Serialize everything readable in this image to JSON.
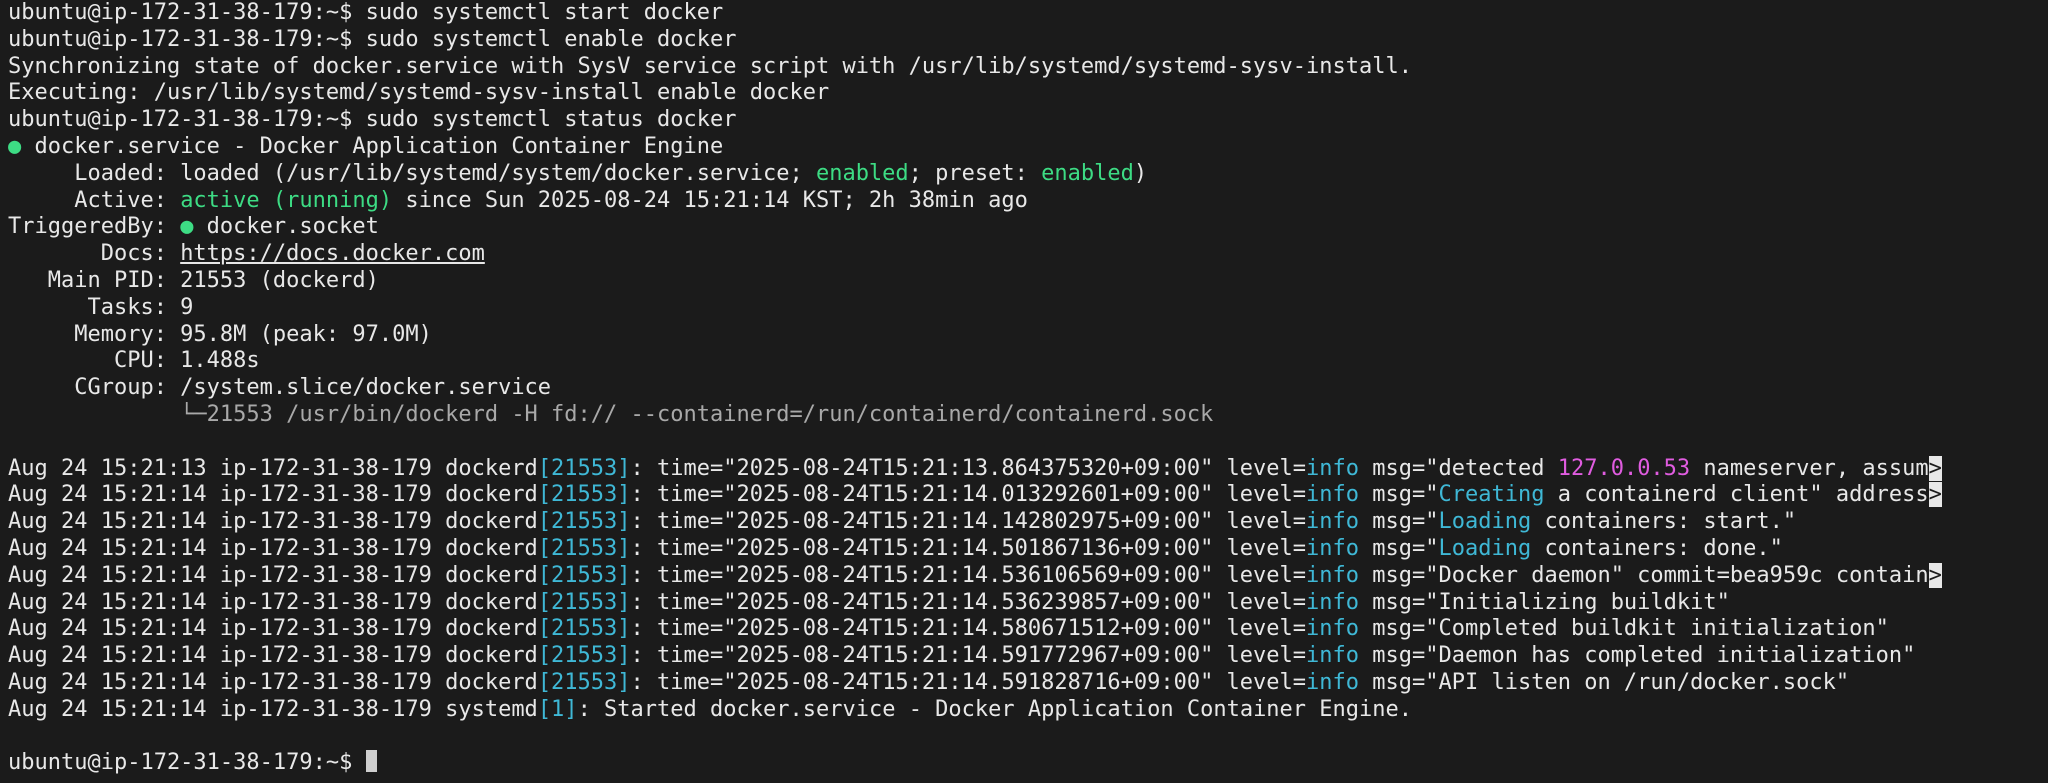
{
  "terminal": {
    "lines": [
      [
        {
          "t": "ubuntu@ip-172-31-38-179:~$ sudo systemctl start docker"
        }
      ],
      [
        {
          "t": "ubuntu@ip-172-31-38-179:~$ sudo systemctl enable docker"
        }
      ],
      [
        {
          "t": "Synchronizing state of docker.service with SysV service script with /usr/lib/systemd/systemd-sysv-install."
        }
      ],
      [
        {
          "t": "Executing: /usr/lib/systemd/systemd-sysv-install enable docker"
        }
      ],
      [
        {
          "t": "ubuntu@ip-172-31-38-179:~$ sudo systemctl status docker"
        }
      ],
      [
        {
          "t": "●",
          "c": "green"
        },
        {
          "t": " docker.service - Docker Application Container Engine"
        }
      ],
      [
        {
          "t": "     Loaded: loaded (/usr/lib/systemd/system/docker.service; "
        },
        {
          "t": "enabled",
          "c": "green"
        },
        {
          "t": "; preset: "
        },
        {
          "t": "enabled",
          "c": "green"
        },
        {
          "t": ")"
        }
      ],
      [
        {
          "t": "     Active: "
        },
        {
          "t": "active (running)",
          "c": "green"
        },
        {
          "t": " since Sun 2025-08-24 15:21:14 KST; 2h 38min ago"
        }
      ],
      [
        {
          "t": "TriggeredBy: "
        },
        {
          "t": "●",
          "c": "green"
        },
        {
          "t": " docker.socket"
        }
      ],
      [
        {
          "t": "       Docs: "
        },
        {
          "t": "https://docs.docker.com",
          "c": "link"
        }
      ],
      [
        {
          "t": "   Main PID: 21553 (dockerd)"
        }
      ],
      [
        {
          "t": "      Tasks: 9"
        }
      ],
      [
        {
          "t": "     Memory: 95.8M (peak: 97.0M)"
        }
      ],
      [
        {
          "t": "        CPU: 1.488s"
        }
      ],
      [
        {
          "t": "     CGroup: /system.slice/docker.service"
        }
      ],
      [
        {
          "t": "             └─21553 /usr/bin/dockerd -H fd:// --containerd=/run/containerd/containerd.sock",
          "c": "gray"
        }
      ],
      [
        {
          "t": ""
        }
      ],
      [
        {
          "t": "Aug 24 15:21:13 ip-172-31-38-179 dockerd"
        },
        {
          "t": "[21553]",
          "c": "cyan"
        },
        {
          "t": ": time=\"2025-08-24T15:21:13.864375320+09:00\" level="
        },
        {
          "t": "info",
          "c": "cyan"
        },
        {
          "t": " msg=\"detected "
        },
        {
          "t": "127.0.0.53",
          "c": "magenta"
        },
        {
          "t": " nameserver, assum"
        },
        {
          "t": ">",
          "c": "trunc"
        }
      ],
      [
        {
          "t": "Aug 24 15:21:14 ip-172-31-38-179 dockerd"
        },
        {
          "t": "[21553]",
          "c": "cyan"
        },
        {
          "t": ": time=\"2025-08-24T15:21:14.013292601+09:00\" level="
        },
        {
          "t": "info",
          "c": "cyan"
        },
        {
          "t": " msg=\""
        },
        {
          "t": "Creating",
          "c": "cyan"
        },
        {
          "t": " a containerd client\" address"
        },
        {
          "t": ">",
          "c": "trunc"
        }
      ],
      [
        {
          "t": "Aug 24 15:21:14 ip-172-31-38-179 dockerd"
        },
        {
          "t": "[21553]",
          "c": "cyan"
        },
        {
          "t": ": time=\"2025-08-24T15:21:14.142802975+09:00\" level="
        },
        {
          "t": "info",
          "c": "cyan"
        },
        {
          "t": " msg=\""
        },
        {
          "t": "Loading",
          "c": "cyan"
        },
        {
          "t": " containers: start.\""
        }
      ],
      [
        {
          "t": "Aug 24 15:21:14 ip-172-31-38-179 dockerd"
        },
        {
          "t": "[21553]",
          "c": "cyan"
        },
        {
          "t": ": time=\"2025-08-24T15:21:14.501867136+09:00\" level="
        },
        {
          "t": "info",
          "c": "cyan"
        },
        {
          "t": " msg=\""
        },
        {
          "t": "Loading",
          "c": "cyan"
        },
        {
          "t": " containers: done.\""
        }
      ],
      [
        {
          "t": "Aug 24 15:21:14 ip-172-31-38-179 dockerd"
        },
        {
          "t": "[21553]",
          "c": "cyan"
        },
        {
          "t": ": time=\"2025-08-24T15:21:14.536106569+09:00\" level="
        },
        {
          "t": "info",
          "c": "cyan"
        },
        {
          "t": " msg=\"Docker daemon\" commit=bea959c contain"
        },
        {
          "t": ">",
          "c": "trunc"
        }
      ],
      [
        {
          "t": "Aug 24 15:21:14 ip-172-31-38-179 dockerd"
        },
        {
          "t": "[21553]",
          "c": "cyan"
        },
        {
          "t": ": time=\"2025-08-24T15:21:14.536239857+09:00\" level="
        },
        {
          "t": "info",
          "c": "cyan"
        },
        {
          "t": " msg=\"Initializing buildkit\""
        }
      ],
      [
        {
          "t": "Aug 24 15:21:14 ip-172-31-38-179 dockerd"
        },
        {
          "t": "[21553]",
          "c": "cyan"
        },
        {
          "t": ": time=\"2025-08-24T15:21:14.580671512+09:00\" level="
        },
        {
          "t": "info",
          "c": "cyan"
        },
        {
          "t": " msg=\"Completed buildkit initialization\""
        }
      ],
      [
        {
          "t": "Aug 24 15:21:14 ip-172-31-38-179 dockerd"
        },
        {
          "t": "[21553]",
          "c": "cyan"
        },
        {
          "t": ": time=\"2025-08-24T15:21:14.591772967+09:00\" level="
        },
        {
          "t": "info",
          "c": "cyan"
        },
        {
          "t": " msg=\"Daemon has completed initialization\""
        }
      ],
      [
        {
          "t": "Aug 24 15:21:14 ip-172-31-38-179 dockerd"
        },
        {
          "t": "[21553]",
          "c": "cyan"
        },
        {
          "t": ": time=\"2025-08-24T15:21:14.591828716+09:00\" level="
        },
        {
          "t": "info",
          "c": "cyan"
        },
        {
          "t": " msg=\"API listen on /run/docker.sock\""
        }
      ],
      [
        {
          "t": "Aug 24 15:21:14 ip-172-31-38-179 systemd"
        },
        {
          "t": "[1]",
          "c": "cyan"
        },
        {
          "t": ": Started docker.service - Docker Application Container Engine."
        }
      ],
      [
        {
          "t": ""
        }
      ],
      [
        {
          "t": "ubuntu@ip-172-31-38-179:~$ "
        }
      ]
    ]
  },
  "colors": {
    "background": "#1b1b1b",
    "foreground": "#e8e8e8",
    "green": "#3ddc84",
    "cyan": "#3fb8d6",
    "magenta": "#e05ce0",
    "gray": "#a9a9a9"
  }
}
